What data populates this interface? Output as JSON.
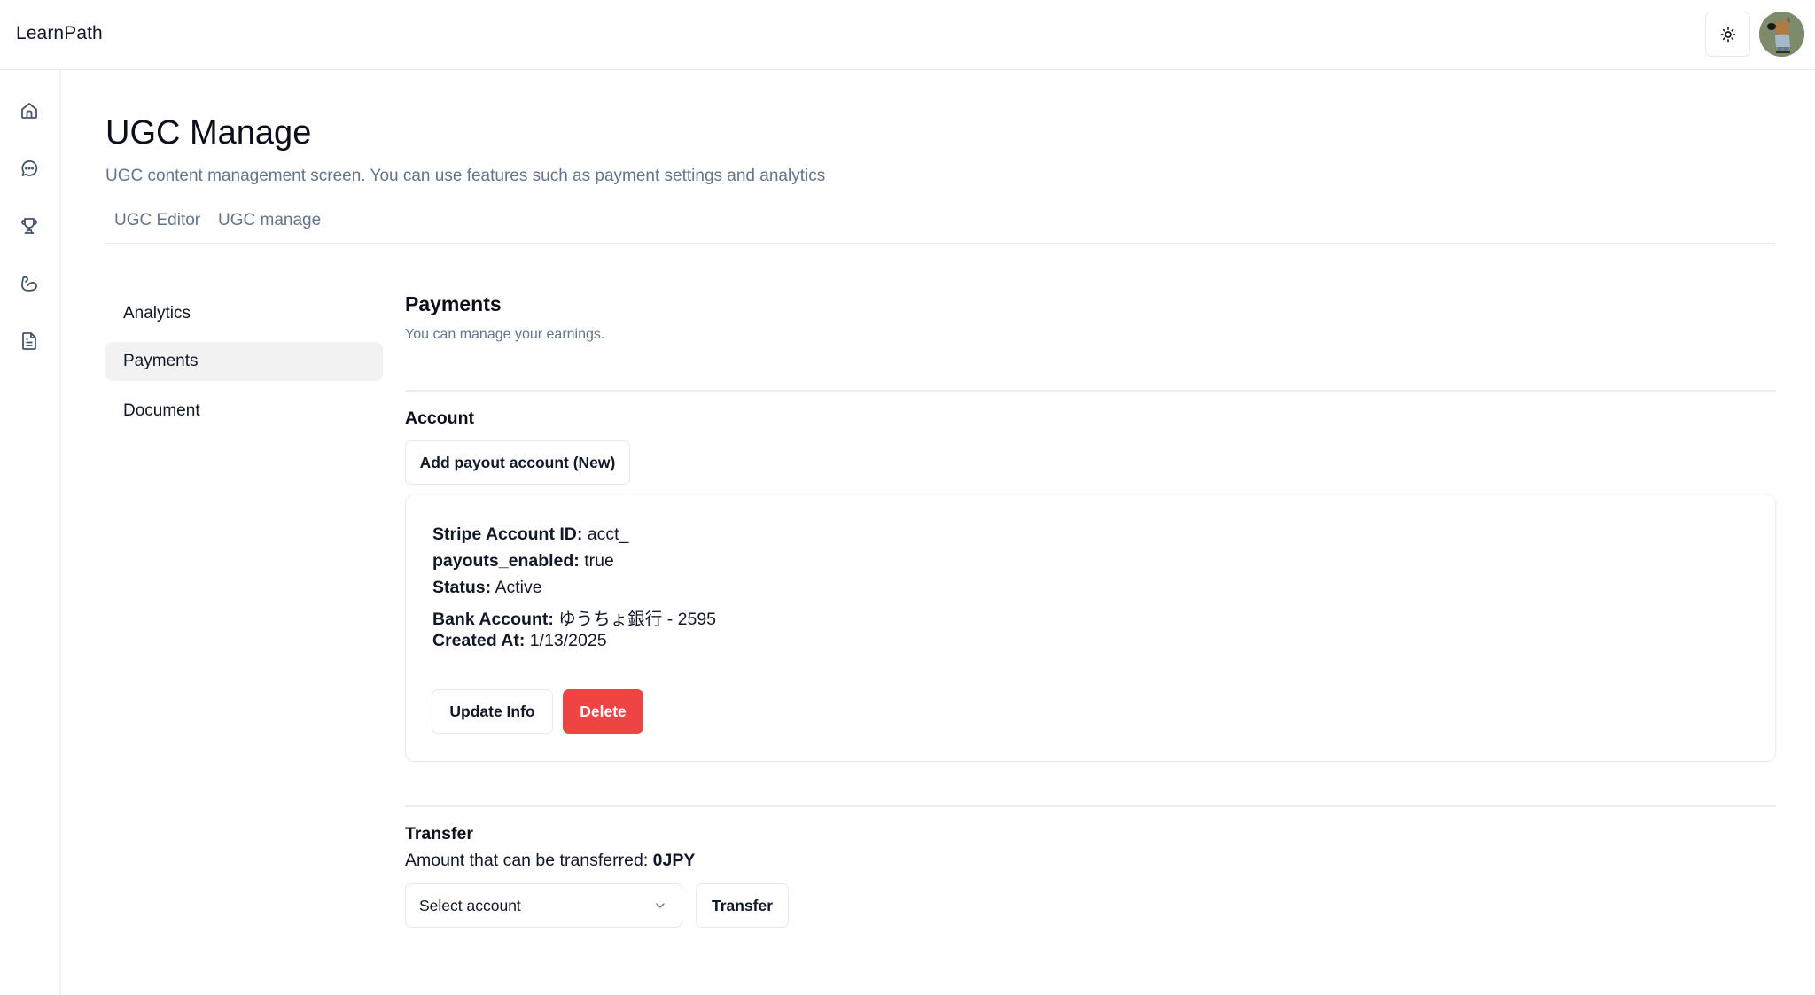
{
  "header": {
    "logo": "LearnPath",
    "theme_toggle_icon": "sun-icon",
    "avatar_alt": "user-avatar"
  },
  "sidebar": {
    "items": [
      {
        "name": "home",
        "icon": "home-icon"
      },
      {
        "name": "chat",
        "icon": "chat-bubble-icon"
      },
      {
        "name": "trophy",
        "icon": "trophy-icon"
      },
      {
        "name": "training",
        "icon": "flexed-bicep-icon"
      },
      {
        "name": "document",
        "icon": "document-icon"
      }
    ]
  },
  "page": {
    "title": "UGC Manage",
    "subtitle": "UGC content management screen. You can use features such as payment settings and analytics",
    "tabs": [
      {
        "label": "UGC Editor"
      },
      {
        "label": "UGC manage"
      }
    ]
  },
  "subnav": {
    "items": [
      {
        "label": "Analytics",
        "active": false
      },
      {
        "label": "Payments",
        "active": true
      },
      {
        "label": "Document",
        "active": false
      }
    ]
  },
  "payments": {
    "title": "Payments",
    "subtitle": "You can manage your earnings.",
    "account": {
      "heading": "Account",
      "add_button": "Add payout account (New)",
      "card": {
        "fields": [
          {
            "label": "Stripe Account ID:",
            "value": "acct_"
          },
          {
            "label": "payouts_enabled:",
            "value": "true"
          },
          {
            "label": "Status:",
            "value": "Active"
          },
          {
            "label": "Bank Account:",
            "value": "ゆうちょ銀行 - 2595"
          },
          {
            "label": "Created At:",
            "value": "1/13/2025"
          }
        ],
        "update_button": "Update Info",
        "delete_button": "Delete"
      }
    },
    "transfer": {
      "heading": "Transfer",
      "amount_label": "Amount that can be transferred:",
      "amount_value": "0JPY",
      "select_value": "Select account",
      "transfer_button": "Transfer"
    }
  },
  "colors": {
    "danger": "#ef4444",
    "muted_text": "#64748b",
    "border": "#e5e9f0",
    "active_nav_bg": "#f2f2f3"
  }
}
